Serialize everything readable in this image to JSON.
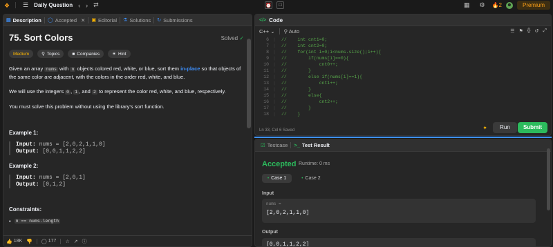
{
  "topbar": {
    "title": "Daily Question",
    "streak": "2",
    "premium": "Premium"
  },
  "left": {
    "tabs": [
      {
        "label": "Description"
      },
      {
        "label": "Accepted"
      },
      {
        "label": "Editorial"
      },
      {
        "label": "Solutions"
      },
      {
        "label": "Submissions"
      }
    ],
    "problem": {
      "title": "75. Sort Colors",
      "status": "Solved",
      "difficulty": "Medium",
      "chips": [
        "Topics",
        "Companies",
        "Hint"
      ],
      "p1_a": "Given an array",
      "p1_code1": "nums",
      "p1_b": "with",
      "p1_code2": "n",
      "p1_c": "objects colored red, white, or blue, sort them",
      "p1_link": "in-place",
      "p1_d": "so that objects of the same color are adjacent, with the colors in the order red, white, and blue.",
      "p2_a": "We will use the integers",
      "p2_c0": "0",
      "p2_c1": "1",
      "p2_b": "and",
      "p2_c2": "2",
      "p2_d": "to represent the color red, white, and blue, respectively.",
      "p3": "You must solve this problem without using the library's sort function.",
      "ex1_title": "Example 1:",
      "ex1_in_label": "Input:",
      "ex1_in": "nums = [2,0,2,1,1,0]",
      "ex1_out_label": "Output:",
      "ex1_out": "[0,0,1,1,2,2]",
      "ex2_title": "Example 2:",
      "ex2_in_label": "Input:",
      "ex2_in": "nums = [2,0,1]",
      "ex2_out_label": "Output:",
      "ex2_out": "[0,1,2]",
      "constraints_title": "Constraints:",
      "constraint1": "n == nums.length"
    },
    "footer": {
      "likes": "18K",
      "comments": "177"
    }
  },
  "code": {
    "header": "Code",
    "language": "C++",
    "mode": "Auto",
    "lines": [
      {
        "n": "6",
        "t": "//    int cnt1=0;"
      },
      {
        "n": "7",
        "t": "//    int cnt2=0;"
      },
      {
        "n": "8",
        "t": "//    for(int i=0;i<nums.size();i++){"
      },
      {
        "n": "9",
        "t": "//        if(nums[i]==0){"
      },
      {
        "n": "10",
        "t": "//            cnt0++;"
      },
      {
        "n": "11",
        "t": "//        }"
      },
      {
        "n": "12",
        "t": "//        else if(nums[i]==1){"
      },
      {
        "n": "13",
        "t": "//            cnt1++;"
      },
      {
        "n": "14",
        "t": "//        }"
      },
      {
        "n": "15",
        "t": "//        else{"
      },
      {
        "n": "16",
        "t": "//            cnt2++;"
      },
      {
        "n": "17",
        "t": "//        }"
      },
      {
        "n": "18",
        "t": "//    }"
      }
    ],
    "status": "Ln 33, Col 6    Saved",
    "run": "Run",
    "submit": "Submit"
  },
  "test": {
    "tabs": [
      {
        "label": "Testcase"
      },
      {
        "label": "Test Result"
      }
    ],
    "result": "Accepted",
    "runtime": "Runtime: 0 ms",
    "cases": [
      "Case 1",
      "Case 2"
    ],
    "input_label": "Input",
    "input_name": "nums =",
    "input_value": "[2,0,2,1,1,0]",
    "output_label": "Output",
    "output_value": "[0,0,1,1,2,2]"
  }
}
